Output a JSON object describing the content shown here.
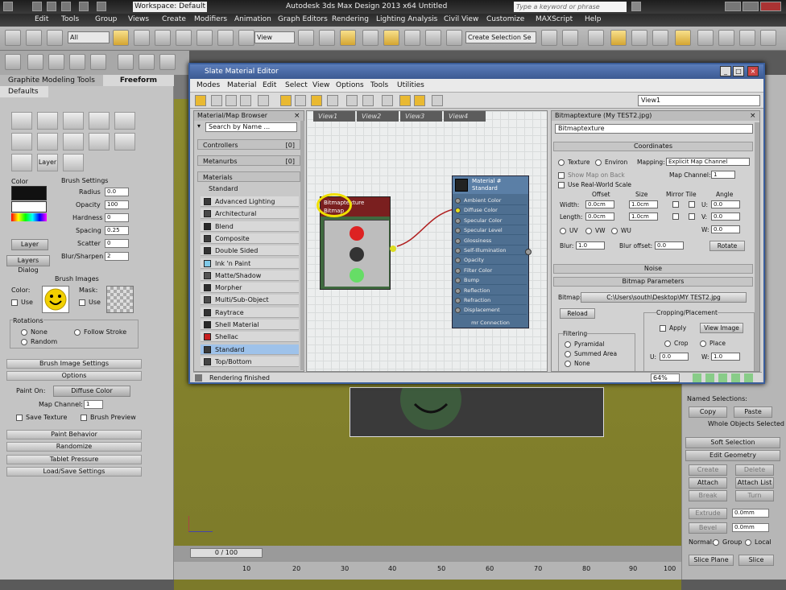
{
  "titlebar": {
    "workspace": "Workspace: Default",
    "app_title": "Autodesk 3ds Max Design 2013 x64     Untitled",
    "search_placeholder": "Type a keyword or phrase"
  },
  "menubar": {
    "items": [
      "Edit",
      "Tools",
      "Group",
      "Views",
      "Create",
      "Modifiers",
      "Animation",
      "Graph Editors",
      "Rendering",
      "Lighting Analysis",
      "Civil View",
      "Customize",
      "MAXScript",
      "Help"
    ]
  },
  "toolbar": {
    "filter_select": "All",
    "ref_coord": "View",
    "selection_set_placeholder": "Create Selection Se"
  },
  "left_panel": {
    "ribbon_tabs": [
      "Graphite Modeling Tools",
      "Freeform"
    ],
    "sub_tab": "Defaults",
    "layer_label": "Layer",
    "color_label": "Color",
    "brush_settings": {
      "title": "Brush Settings",
      "fields": [
        {
          "label": "Radius",
          "value": "0.0"
        },
        {
          "label": "Opacity",
          "value": "100"
        },
        {
          "label": "Hardness",
          "value": "0"
        },
        {
          "label": "Spacing",
          "value": "0.25"
        },
        {
          "label": "Scatter",
          "value": "0"
        },
        {
          "label": "Blur/Sharpen",
          "value": "2"
        }
      ]
    },
    "buttons": [
      "Layer",
      "Layers Dialog"
    ],
    "brush_images": {
      "title": "Brush Images",
      "color_label": "Color:",
      "mask_label": "Mask:",
      "use_label": "Use"
    },
    "rotations": {
      "title": "Rotations",
      "options": [
        "None",
        "Random",
        "Follow Stroke"
      ]
    },
    "sections": [
      "Brush Image Settings",
      "Options",
      "Paint Behavior",
      "Randomize",
      "Tablet Pressure",
      "Load/Save Settings"
    ],
    "options": {
      "paint_on_label": "Paint On:",
      "paint_on_value": "Diffuse Color",
      "map_channel_label": "Map Channel:",
      "map_channel_value": "1",
      "save_texture": "Save Texture",
      "brush_preview": "Brush Preview"
    }
  },
  "viewport": {
    "frame_counter": "0 / 100",
    "ruler": [
      "10",
      "20",
      "30",
      "40",
      "50",
      "60",
      "70",
      "80",
      "90",
      "100"
    ]
  },
  "right_panel": {
    "named_selections": "Named Selections:",
    "named_buttons": [
      "Copy",
      "Paste"
    ],
    "whole_objects": "Whole Objects Selected",
    "soft_selection": "Soft Selection",
    "edit_geometry": "Edit Geometry",
    "buttons": [
      "Create",
      "Delete",
      "Attach",
      "Attach List",
      "Break",
      "Turn",
      "Extrude",
      "Bevel",
      "Slice Plane",
      "Slice"
    ],
    "field_value": "0.0mm",
    "normal_label": "Normal:",
    "normal_options": [
      "Group",
      "Local"
    ]
  },
  "slate": {
    "title": "Slate Material Editor",
    "menu": [
      "Modes",
      "Material",
      "Edit",
      "Select",
      "View",
      "Options",
      "Tools",
      "Utilities"
    ],
    "view_dropdown": "View1",
    "browser": {
      "title": "Material/Map Browser",
      "search_placeholder": "Search by Name ...",
      "sections": [
        "Controllers",
        "Metanurbs",
        "Materials"
      ],
      "section_count": "[0]",
      "subsection": "Standard",
      "items": [
        {
          "label": "Advanced Lighting",
          "swatch": "#3a3a3a"
        },
        {
          "label": "Architectural",
          "swatch": "#4a4a4a"
        },
        {
          "label": "Blend",
          "swatch": "#2a2a2a"
        },
        {
          "label": "Composite",
          "swatch": "#3d3d3d"
        },
        {
          "label": "Double Sided",
          "swatch": "#333333"
        },
        {
          "label": "Ink 'n Paint",
          "swatch": "#7fc9e8"
        },
        {
          "label": "Matte/Shadow",
          "swatch": "#555555"
        },
        {
          "label": "Morpher",
          "swatch": "#2d2d2d"
        },
        {
          "label": "Multi/Sub-Object",
          "swatch": "#4b4b4b"
        },
        {
          "label": "Raytrace",
          "swatch": "#333333"
        },
        {
          "label": "Shell Material",
          "swatch": "#2a2a2a"
        },
        {
          "label": "Shellac",
          "swatch": "#c81e1e"
        },
        {
          "label": "Standard",
          "swatch": "#3a3a3a"
        },
        {
          "label": "Top/Bottom",
          "swatch": "#444444"
        }
      ],
      "selected_index": 12
    },
    "view_tabs": [
      "View1",
      "View2",
      "View3",
      "View4"
    ],
    "bitmap_node": {
      "title": "Bitmaptexture",
      "subtitle": "Bitmap"
    },
    "material_node": {
      "title": "Material #",
      "subtitle": "Standard",
      "slots": [
        "Ambient Color",
        "Diffuse Color",
        "Specular Color",
        "Specular Level",
        "Glossiness",
        "Self-Illumination",
        "Opacity",
        "Filter Color",
        "Bump",
        "Reflection",
        "Refraction",
        "Displacement"
      ],
      "footer": "mr Connection"
    },
    "params": {
      "header": "Bitmaptexture (My TEST2.jpg)",
      "name_field": "Bitmaptexture",
      "coordinates_title": "Coordinates",
      "texture_label": "Texture",
      "environ_label": "Environ",
      "mapping_label": "Mapping:",
      "mapping_value": "Explicit Map Channel",
      "show_map": "Show Map on Back",
      "map_channel_label": "Map Channel:",
      "map_channel_value": "1",
      "real_world": "Use Real-World Scale",
      "col_offset": "Offset",
      "col_size": "Size",
      "col_mirror": "Mirror Tile",
      "col_angle": "Angle",
      "width_label": "Width:",
      "height_label": "Length:",
      "width_offset": "0.0cm",
      "width_size": "1.0cm",
      "height_offset": "0.0cm",
      "height_size": "1.0cm",
      "u_label": "U:",
      "v_label": "V:",
      "w_label": "W:",
      "angle_u": "0.0",
      "angle_v": "0.0",
      "angle_w": "0.0",
      "uvw": [
        "UV",
        "VW",
        "WU"
      ],
      "blur_label": "Blur:",
      "blur_value": "1.0",
      "blur_offset_label": "Blur offset:",
      "blur_offset_value": "0.0",
      "rotate_btn": "Rotate",
      "noise_bar": "Noise",
      "bitmap_params_bar": "Bitmap Parameters",
      "bitmap_label": "Bitmap:",
      "bitmap_path": "C:\\Users\\south\\Desktop\\MY TEST2.jpg",
      "reload_btn": "Reload",
      "filtering_title": "Filtering",
      "filtering_options": [
        "Pyramidal",
        "Summed Area",
        "None"
      ],
      "cropping_title": "Cropping/Placement",
      "apply_label": "Apply",
      "view_image_btn": "View Image",
      "crop_label": "Crop",
      "place_label": "Place",
      "u_crop": "0.0",
      "w_crop": "1.0"
    },
    "status": "Rendering finished",
    "zoom": "64%"
  }
}
